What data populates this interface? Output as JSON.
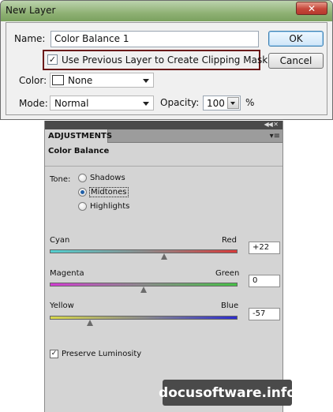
{
  "dialog": {
    "title": "New Layer",
    "close_icon": "close-icon",
    "name_label": "Name:",
    "name_value": "Color Balance 1",
    "ok_label": "OK",
    "cancel_label": "Cancel",
    "clipping_label": "Use Previous Layer to Create Clipping Mask",
    "clipping_checked": true,
    "color_label": "Color:",
    "color_value": "None",
    "mode_label": "Mode:",
    "mode_value": "Normal",
    "opacity_label": "Opacity:",
    "opacity_value": "100",
    "opacity_unit": "%"
  },
  "adjustments": {
    "tab_label": "ADJUSTMENTS",
    "heading": "Color Balance",
    "tone_label": "Tone:",
    "tones": [
      {
        "label": "Shadows",
        "selected": false
      },
      {
        "label": "Midtones",
        "selected": true
      },
      {
        "label": "Highlights",
        "selected": false
      }
    ],
    "sliders": [
      {
        "left_label": "Cyan",
        "right_label": "Red",
        "value": "+22",
        "level": 22
      },
      {
        "left_label": "Magenta",
        "right_label": "Green",
        "value": "0",
        "level": 0
      },
      {
        "left_label": "Yellow",
        "right_label": "Blue",
        "value": "-57",
        "level": -57
      }
    ],
    "slider_range": [
      -100,
      100
    ],
    "preserve_label": "Preserve Luminosity",
    "preserve_checked": true
  },
  "watermark": "docusoftware.info",
  "colors": {
    "titlebar": "#8fb174",
    "close_button": "#c6473a",
    "clip_highlight": "#6b1a1a",
    "panel_bg": "#d4d4d4"
  }
}
